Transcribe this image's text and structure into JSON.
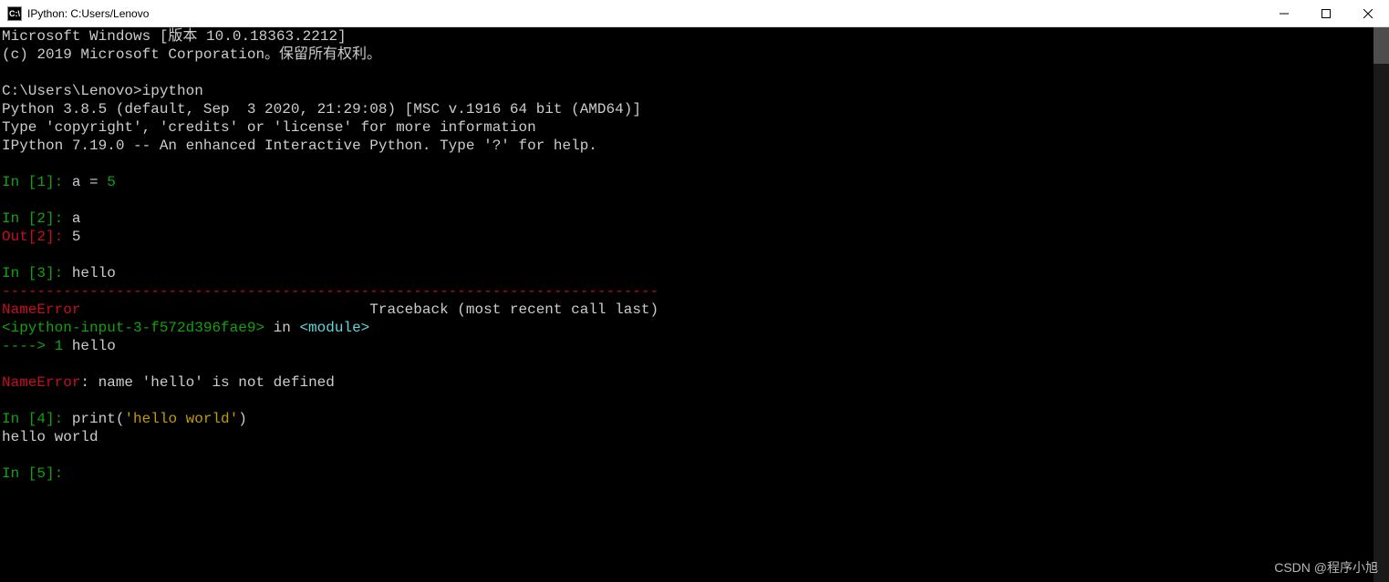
{
  "window": {
    "title": "IPython: C:Users/Lenovo",
    "icon_label": "C:\\"
  },
  "header": {
    "win_version": "Microsoft Windows [版本 10.0.18363.2212]",
    "copyright": "(c) 2019 Microsoft Corporation。保留所有权利。"
  },
  "shell": {
    "prompt_path": "C:\\Users\\Lenovo>",
    "command": "ipython"
  },
  "python": {
    "line1": "Python 3.8.5 (default, Sep  3 2020, 21:29:08) [MSC v.1916 64 bit (AMD64)]",
    "line2": "Type 'copyright', 'credits' or 'license' for more information",
    "line3": "IPython 7.19.0 -- An enhanced Interactive Python. Type '?' for help."
  },
  "cells": {
    "in1": {
      "prompt": "In [1]: ",
      "code_a": "a ",
      "code_eq": "= ",
      "code_val": "5"
    },
    "in2": {
      "prompt": "In [2]: ",
      "code": "a"
    },
    "out2": {
      "prompt": "Out[2]: ",
      "value": "5"
    },
    "in3": {
      "prompt": "In [3]: ",
      "code": "hello"
    },
    "in4": {
      "prompt": "In [4]: ",
      "func": "print",
      "paren_open": "(",
      "string": "'hello world'",
      "paren_close": ")"
    },
    "in4_output": "hello world",
    "in5": {
      "prompt": "In [5]: "
    }
  },
  "traceback": {
    "rule": "---------------------------------------------------------------------------",
    "err_name": "NameError",
    "tb_label": "                                 Traceback (most recent call last)",
    "frame_ref": "<ipython-input-3-f572d396fae9>",
    "in_word": " in ",
    "module": "<module>",
    "arrow": "----> 1",
    "arrow_code": " hello",
    "final_err": "NameError",
    "final_msg": ": name 'hello' is not defined"
  },
  "watermark": "CSDN @程序小旭"
}
